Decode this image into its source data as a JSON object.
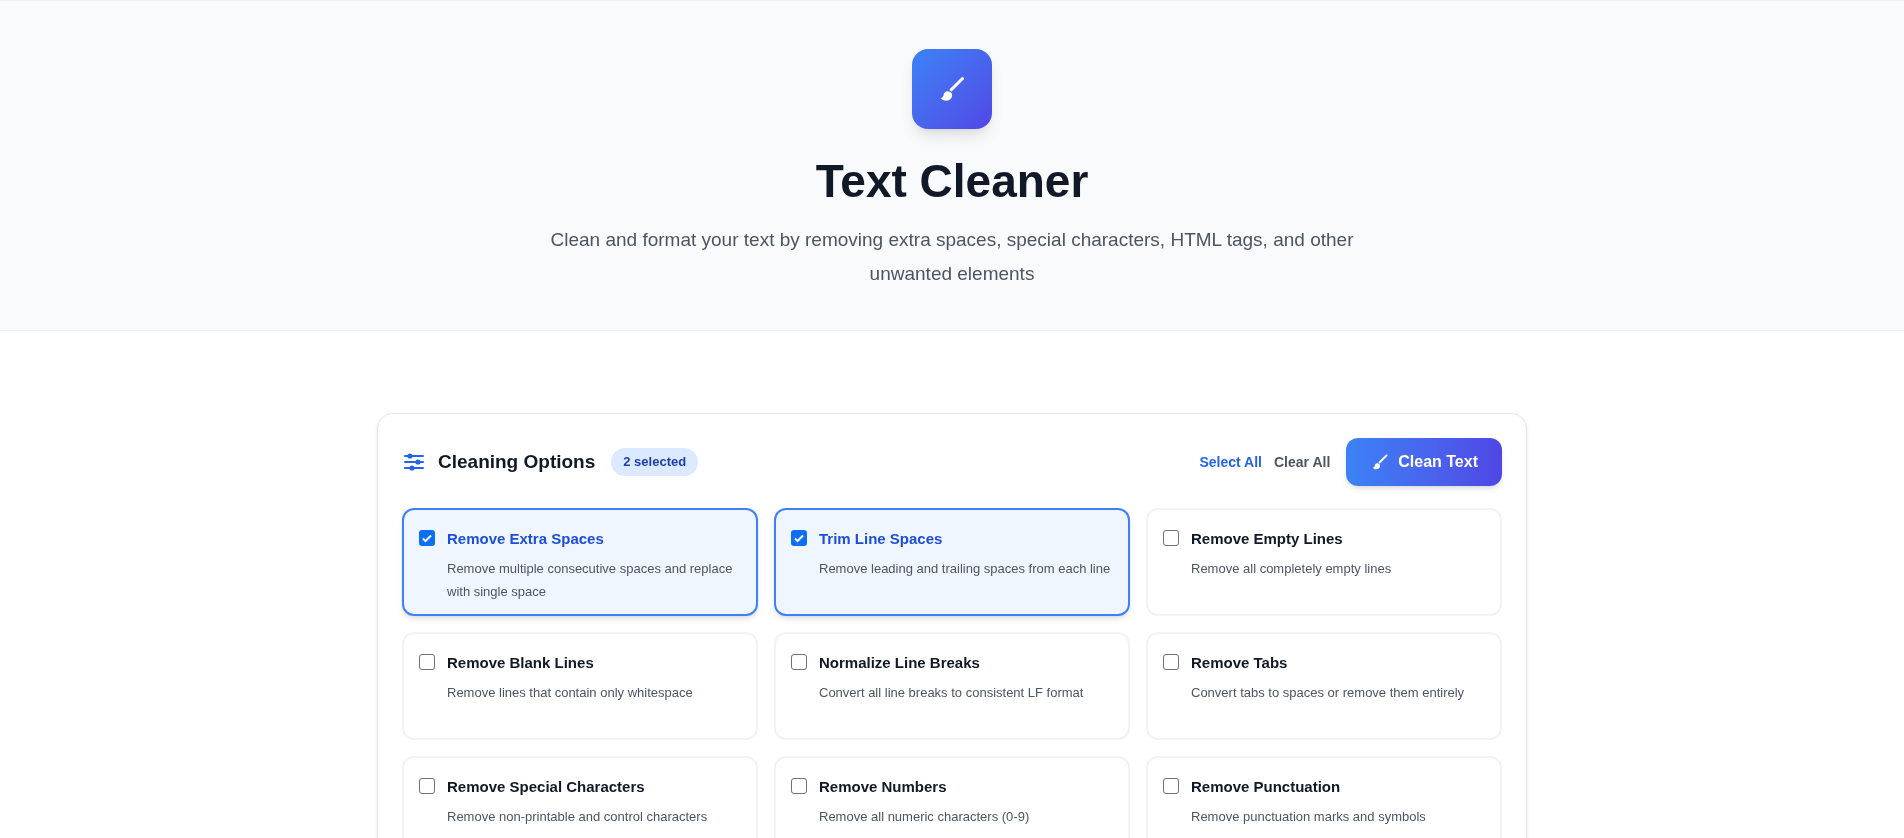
{
  "header": {
    "title": "Text Cleaner",
    "subtitle": "Clean and format your text by removing extra spaces, special characters, HTML tags, and other unwanted elements"
  },
  "options_panel": {
    "title": "Cleaning Options",
    "selected_count": "2 selected",
    "select_all": "Select All",
    "clear_all": "Clear All",
    "clean_button": "Clean Text",
    "options": [
      {
        "title": "Remove Extra Spaces",
        "description": "Remove multiple consecutive spaces and replace with single space",
        "checked": true
      },
      {
        "title": "Trim Line Spaces",
        "description": "Remove leading and trailing spaces from each line",
        "checked": true
      },
      {
        "title": "Remove Empty Lines",
        "description": "Remove all completely empty lines",
        "checked": false
      },
      {
        "title": "Remove Blank Lines",
        "description": "Remove lines that contain only whitespace",
        "checked": false
      },
      {
        "title": "Normalize Line Breaks",
        "description": "Convert all line breaks to consistent LF format",
        "checked": false
      },
      {
        "title": "Remove Tabs",
        "description": "Convert tabs to spaces or remove them entirely",
        "checked": false
      },
      {
        "title": "Remove Special Characters",
        "description": "Remove non-printable and control characters",
        "checked": false
      },
      {
        "title": "Remove Numbers",
        "description": "Remove all numeric characters (0-9)",
        "checked": false
      },
      {
        "title": "Remove Punctuation",
        "description": "Remove punctuation marks and symbols",
        "checked": false
      }
    ]
  }
}
